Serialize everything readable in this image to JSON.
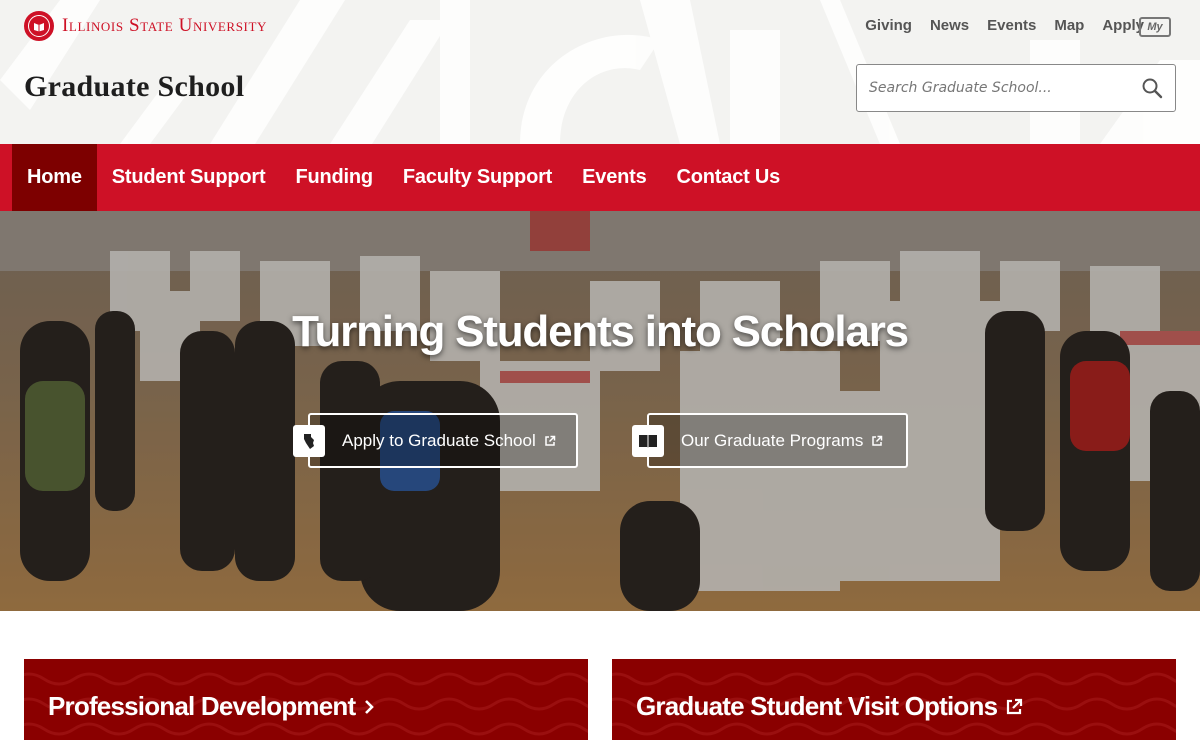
{
  "header": {
    "university_name": "Illinois State University",
    "site_title": "Graduate School",
    "utility_links": [
      "Giving",
      "News",
      "Events",
      "Map",
      "Apply"
    ],
    "my_badge": "My",
    "search_placeholder": "Search Graduate School..."
  },
  "nav": {
    "items": [
      "Home",
      "Student Support",
      "Funding",
      "Faculty Support",
      "Events",
      "Contact Us"
    ],
    "active": "Home"
  },
  "hero": {
    "title": "Turning Students into Scholars",
    "buttons": [
      {
        "label": "Apply to Graduate School",
        "icon": "illinois-state-icon",
        "external": true
      },
      {
        "label": "Our Graduate Programs",
        "icon": "open-book-icon",
        "external": true
      }
    ]
  },
  "cards": [
    {
      "title": "Professional Development",
      "suffix_icon": "chevron-right-icon"
    },
    {
      "title": "Graduate Student Visit Options",
      "suffix_icon": "external-link-icon"
    }
  ],
  "colors": {
    "brand_red": "#ce1126",
    "nav_active": "#7d0000",
    "card_red": "#8a0000",
    "header_bg": "#f3f3f1"
  }
}
